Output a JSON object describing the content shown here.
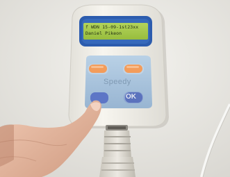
{
  "device": {
    "display_line_1": "f WDN 15-09-1st23xx",
    "display_line_2": "Daniel Pikeon",
    "brand_label": "Speedy",
    "ok_label": "OK"
  },
  "colors": {
    "wall": "#e9e8e3",
    "device_body": "#f1efe8",
    "lcd": "#a6c94a",
    "lcd_bezel": "#2d5fb0",
    "keypad": "#a4c0da",
    "orange_key": "#f39c5b",
    "blue_key": "#5d76c6",
    "cable": "#d9d5cc",
    "skin": "#e7b9a3"
  }
}
